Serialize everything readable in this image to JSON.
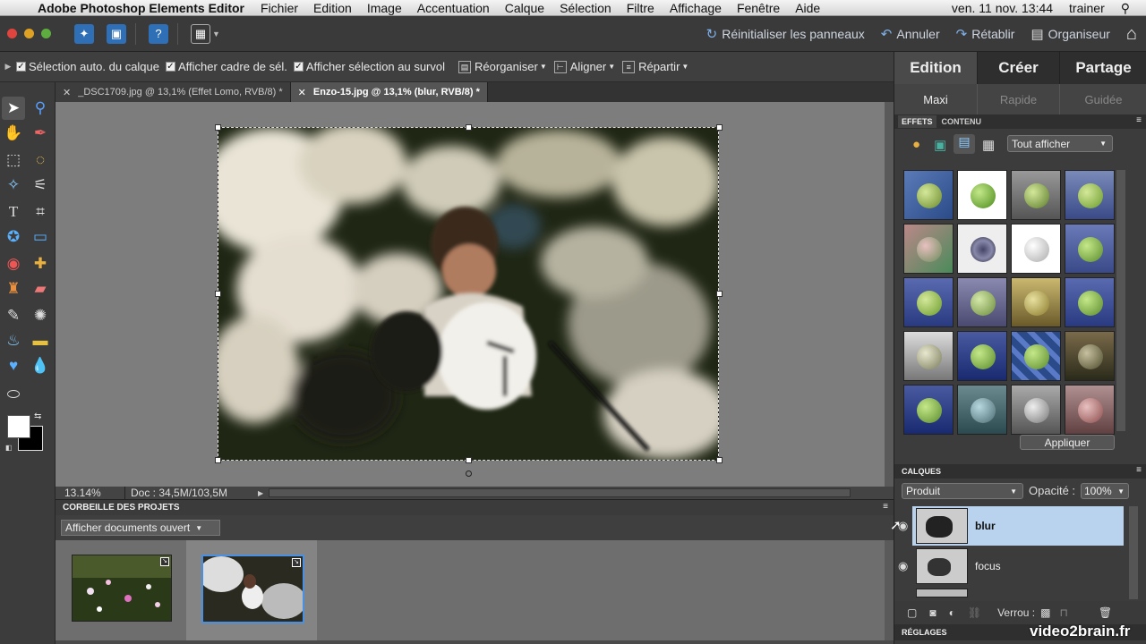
{
  "menubar": {
    "app_name": "Adobe Photoshop Elements Editor",
    "items": [
      "Fichier",
      "Edition",
      "Image",
      "Accentuation",
      "Calque",
      "Sélection",
      "Filtre",
      "Affichage",
      "Fenêtre",
      "Aide"
    ],
    "clock": "ven. 11 nov.  13:44",
    "user": "trainer"
  },
  "toolbar": {
    "reset_panels": "Réinitialiser les panneaux",
    "undo": "Annuler",
    "redo": "Rétablir",
    "organizer": "Organiseur"
  },
  "options": {
    "auto_select": "Sélection auto. du calque",
    "show_bounding": "Afficher cadre de sél.",
    "show_highlight": "Afficher sélection au survol",
    "arrange": "Réorganiser",
    "align": "Aligner",
    "distribute": "Répartir"
  },
  "tabs": [
    {
      "label": "_DSC1709.jpg @ 13,1% (Effet Lomo, RVB/8) *"
    },
    {
      "label": "Enzo-15.jpg @ 13,1% (blur, RVB/8) *"
    }
  ],
  "status": {
    "zoom": "13.14%",
    "doc": "Doc : 34,5M/103,5M"
  },
  "project_bin": {
    "title": "CORBEILLE DES PROJETS",
    "show": "Afficher documents ouvert"
  },
  "right_panel": {
    "main_tabs": [
      "Edition",
      "Créer",
      "Partage"
    ],
    "sub_tabs": [
      "Maxi",
      "Rapide",
      "Guidée"
    ],
    "effects_tab": "EFFETS",
    "content_tab": "CONTENU",
    "filter": "Tout afficher",
    "apply": "Appliquer",
    "layers_title": "CALQUES",
    "blend_mode": "Produit",
    "opacity_label": "Opacité :",
    "opacity_value": "100%",
    "layers": [
      {
        "name": "blur"
      },
      {
        "name": "focus"
      }
    ],
    "lock_label": "Verrou :",
    "adjustments": "RÉGLAGES"
  },
  "watermark": "video2brain.fr"
}
